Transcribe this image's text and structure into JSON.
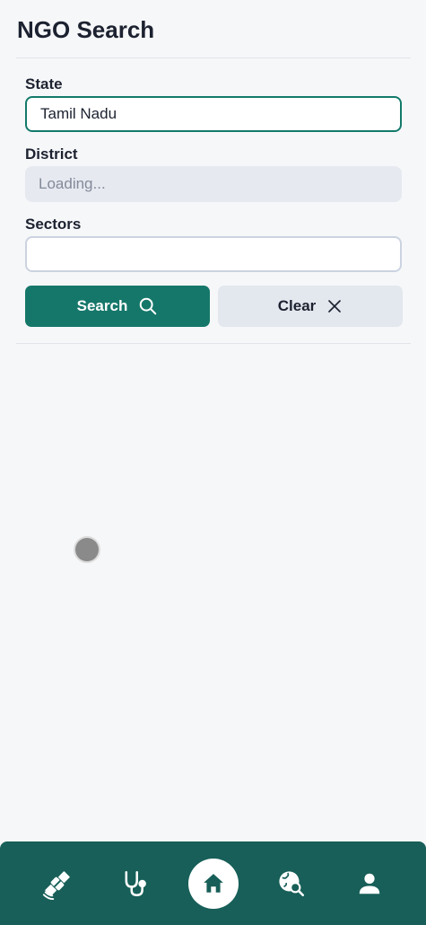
{
  "header": {
    "title": "NGO Search"
  },
  "form": {
    "state_label": "State",
    "state_value": "Tamil Nadu",
    "district_label": "District",
    "district_placeholder": "Loading...",
    "sectors_label": "Sectors",
    "sectors_value": ""
  },
  "actions": {
    "search_label": "Search",
    "clear_label": "Clear"
  },
  "colors": {
    "primary": "#15776a",
    "nav_background": "#175f58",
    "page_background": "#f6f7f9"
  },
  "bottom_nav": {
    "items": [
      {
        "icon": "satellite-icon",
        "active": false
      },
      {
        "icon": "stethoscope-icon",
        "active": false
      },
      {
        "icon": "home-icon",
        "active": true
      },
      {
        "icon": "globe-search-icon",
        "active": false
      },
      {
        "icon": "user-icon",
        "active": false
      }
    ]
  }
}
